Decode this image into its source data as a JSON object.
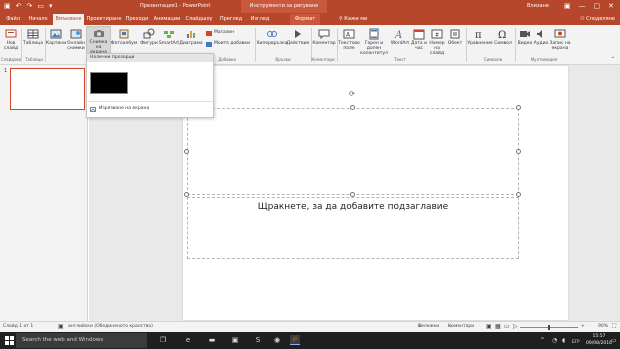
{
  "titlebar": {
    "doc_title": "Презентация1 - PowerPoint",
    "context_group": "Инструменти за рисуване",
    "user": "Влизане",
    "minimize": "—",
    "maximize": "▢",
    "close": "✕"
  },
  "tabs": [
    {
      "label": "Файл"
    },
    {
      "label": "Начало"
    },
    {
      "label": "Вмъкване"
    },
    {
      "label": "Проектиране"
    },
    {
      "label": "Преходи"
    },
    {
      "label": "Анимации"
    },
    {
      "label": "Слайдшоу"
    },
    {
      "label": "Преглед"
    },
    {
      "label": "Изглед"
    },
    {
      "label": "Формат"
    }
  ],
  "tellme": "Кажи ми",
  "share": "Споделяне",
  "ribbon": {
    "new_slide": "Нов слайд",
    "table": "Таблица",
    "images": "Картини",
    "online_images": "Онлайн снимки",
    "screenshot": "Снимка на екрана",
    "photo_album": "Фотоалбум",
    "shapes": "Фигури",
    "smartart": "SmartArt",
    "chart": "Диаграма",
    "store": "Магазин",
    "my_addins": "Моите добавки",
    "hyperlink": "Хипервръзка",
    "action": "Действие",
    "comment": "Коментар",
    "textbox": "Текстово поле",
    "header_footer": "Горен и долен колонтитул",
    "wordart": "WordArt",
    "date_time": "Дата и час",
    "slide_number": "Номер на слайд",
    "object": "Обект",
    "equation": "Уравнение",
    "symbol": "Символ",
    "video": "Видео",
    "audio": "Аудио",
    "screen_recording": "Запис на екрана",
    "groups": {
      "slides": "Слайдове",
      "tables": "Таблици",
      "addins": "Добавки",
      "links": "Връзки",
      "comments": "Коментари",
      "text": "Текст",
      "symbols": "Символи",
      "media": "Мултимедия"
    }
  },
  "dropdown": {
    "header": "Налични прозорци",
    "clipping": "Изрязване на екрана"
  },
  "slide": {
    "slide_number": "1",
    "subtitle_placeholder": "Щракнете, за да добавите подзаглавие"
  },
  "statusbar": {
    "slide_info": "Слайд 1 от 1",
    "language": "английски (Обединеното кралство)",
    "notes": "Бележки",
    "comments": "Коментари",
    "zoom": "90%"
  },
  "taskbar": {
    "search_placeholder": "Search the web and Windows",
    "language": "БГР",
    "time": "15:57",
    "date": "09/08/2016"
  }
}
